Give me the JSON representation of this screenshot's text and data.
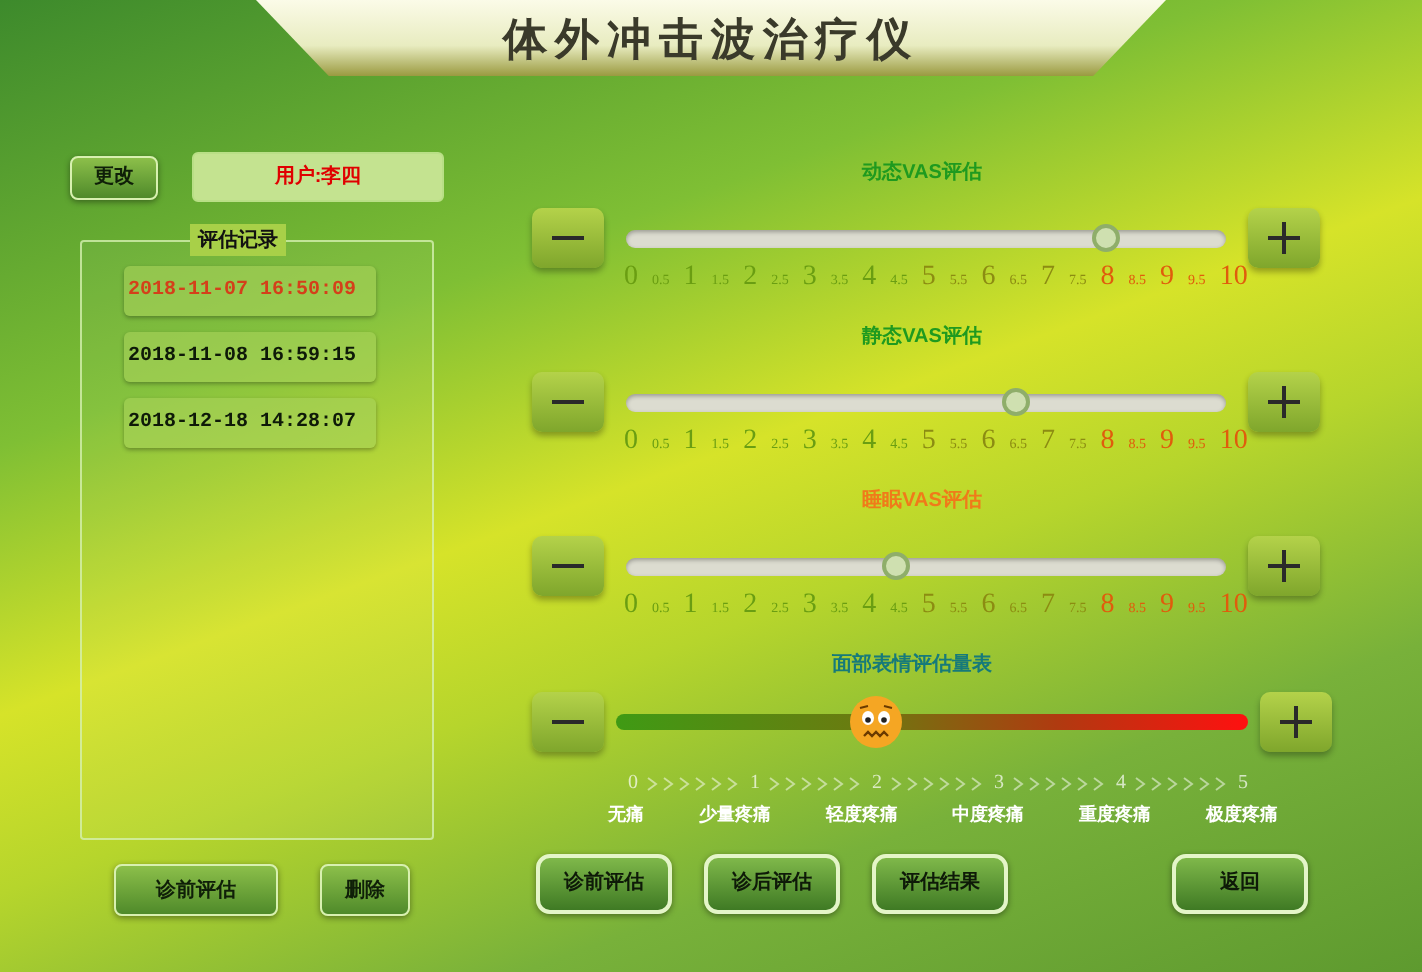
{
  "title": "体外冲击波治疗仪",
  "change_button": "更改",
  "user": "用户:李四",
  "records": {
    "title": "评估记录",
    "items": [
      {
        "text": "2018-11-07 16:50:09",
        "selected": true
      },
      {
        "text": "2018-11-08 16:59:15",
        "selected": false
      },
      {
        "text": "2018-12-18 14:28:07",
        "selected": false
      }
    ]
  },
  "left_buttons": [
    "诊前评估",
    "删除"
  ],
  "vas_sliders": [
    {
      "title": "动态VAS评估",
      "color": "#1f9a1f",
      "level": 0.8,
      "ticks": [
        "0",
        "0.5",
        "1",
        "1.5",
        "2",
        "2.5",
        "3",
        "3.5",
        "4",
        "4.5",
        "5",
        "5.5",
        "6",
        "6.5",
        "7",
        "7.5",
        "8",
        "8.5",
        "9",
        "9.5",
        "10"
      ]
    },
    {
      "title": "静态VAS评估",
      "color": "#1f9a1f",
      "level": 0.65,
      "ticks": [
        "0",
        "0.5",
        "1",
        "1.5",
        "2",
        "2.5",
        "3",
        "3.5",
        "4",
        "4.5",
        "5",
        "5.5",
        "6",
        "6.5",
        "7",
        "7.5",
        "8",
        "8.5",
        "9",
        "9.5",
        "10"
      ]
    },
    {
      "title": "睡眠VAS评估",
      "color": "#f07a1a",
      "level": 0.45,
      "ticks": [
        "0",
        "0.5",
        "1",
        "1.5",
        "2",
        "2.5",
        "3",
        "3.5",
        "4",
        "4.5",
        "5",
        "5.5",
        "6",
        "6.5",
        "7",
        "7.5",
        "8",
        "8.5",
        "9",
        "9.5",
        "10"
      ]
    }
  ],
  "face_scale": {
    "title": "面部表情评估量表",
    "level": 0.41,
    "ticks": [
      "0",
      "1",
      "2",
      "3",
      "4",
      "5"
    ],
    "labels": [
      "无痛",
      "少量疼痛",
      "轻度疼痛",
      "中度疼痛",
      "重度疼痛",
      "极度疼痛"
    ]
  },
  "bottom_buttons": [
    "诊前评估",
    "诊后评估",
    "评估结果",
    "返回"
  ]
}
